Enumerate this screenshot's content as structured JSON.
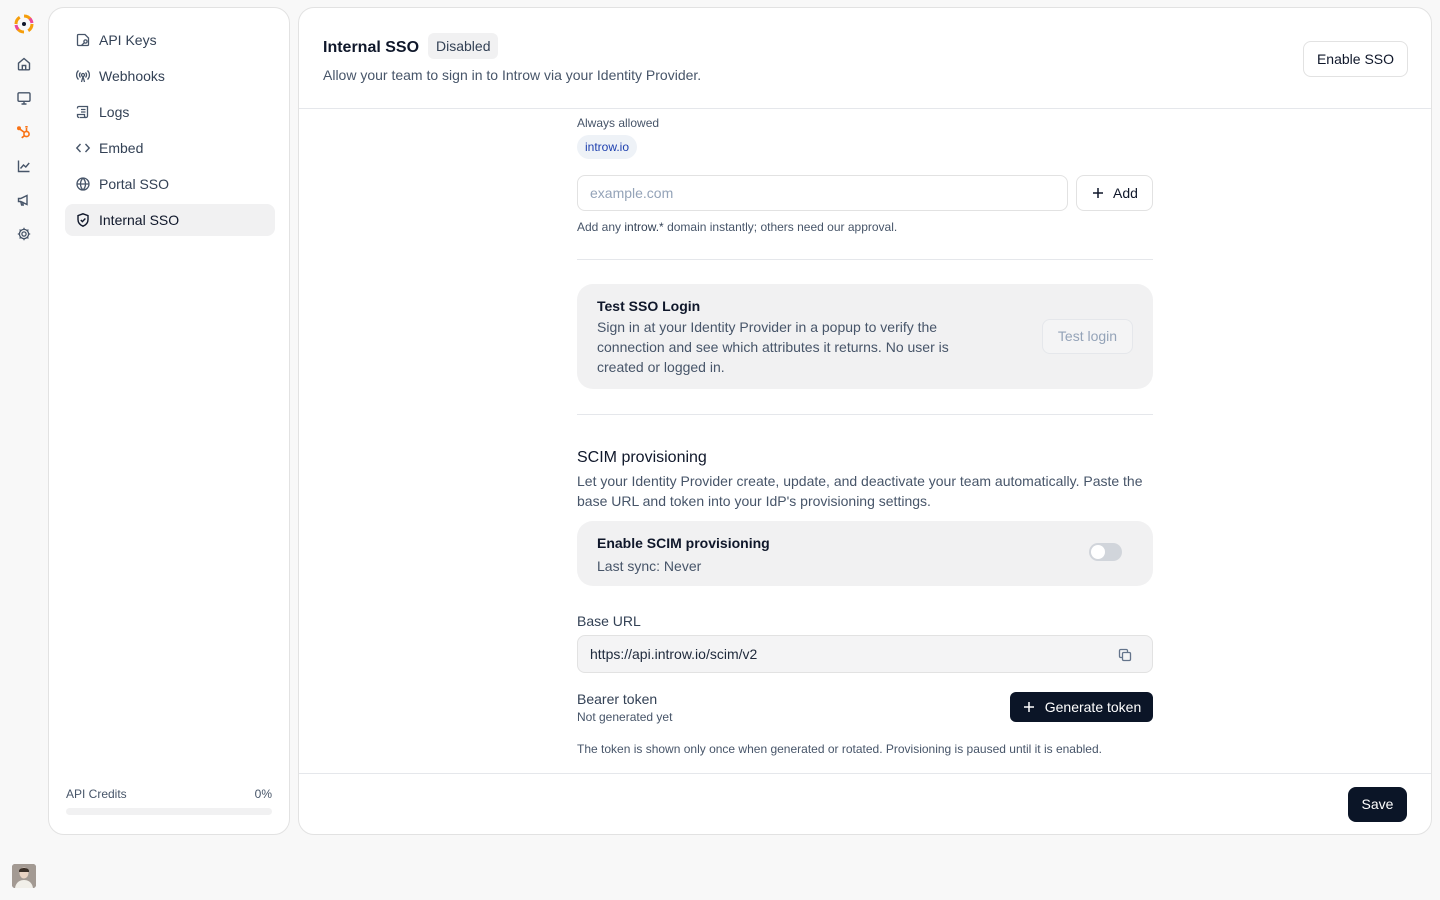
{
  "rail": {
    "items": [
      {
        "icon": "home-icon"
      },
      {
        "icon": "monitor-icon"
      },
      {
        "icon": "hubspot-icon",
        "active": true
      },
      {
        "icon": "chart-icon"
      },
      {
        "icon": "megaphone-icon"
      },
      {
        "icon": "gear-icon"
      }
    ],
    "active_color": "#f97316"
  },
  "sidebar": {
    "items": [
      {
        "label": "API Keys",
        "icon": "key-icon"
      },
      {
        "label": "Webhooks",
        "icon": "webhook-icon"
      },
      {
        "label": "Logs",
        "icon": "logs-icon"
      },
      {
        "label": "Embed",
        "icon": "code-icon"
      },
      {
        "label": "Portal SSO",
        "icon": "globe-icon"
      },
      {
        "label": "Internal SSO",
        "icon": "shield-icon",
        "active": true
      }
    ],
    "credits": {
      "label": "API Credits",
      "value": "0%",
      "fraction": 0
    }
  },
  "header": {
    "title": "Internal SSO",
    "badge": "Disabled",
    "subtitle": "Allow your team to sign in to Introw via your Identity Provider.",
    "enable_label": "Enable SSO"
  },
  "domains": {
    "always_label": "Always allowed",
    "chip": "introw.io",
    "placeholder": "example.com",
    "add_label": "Add",
    "hint_prefix": "Add any ",
    "hint_bold": "introw.*",
    "hint_suffix": " domain instantly; others need our approval."
  },
  "test": {
    "title": "Test SSO Login",
    "description": "Sign in at your Identity Provider in a popup to verify the connection and see which attributes it returns. No user is created or logged in.",
    "button": "Test login"
  },
  "scim": {
    "title": "SCIM provisioning",
    "description": "Let your Identity Provider create, update, and deactivate your team automatically. Paste the base URL and token into your IdP's provisioning settings.",
    "toggle_title": "Enable SCIM provisioning",
    "last_sync": "Last sync: Never",
    "enabled": false,
    "base_url_label": "Base URL",
    "base_url": "https://api.introw.io/scim/v2",
    "token_label": "Bearer token",
    "token_status": "Not generated yet",
    "generate_label": "Generate token",
    "token_hint": "The token is shown only once when generated or rotated. Provisioning is paused until it is enabled."
  },
  "footer": {
    "save_label": "Save"
  }
}
